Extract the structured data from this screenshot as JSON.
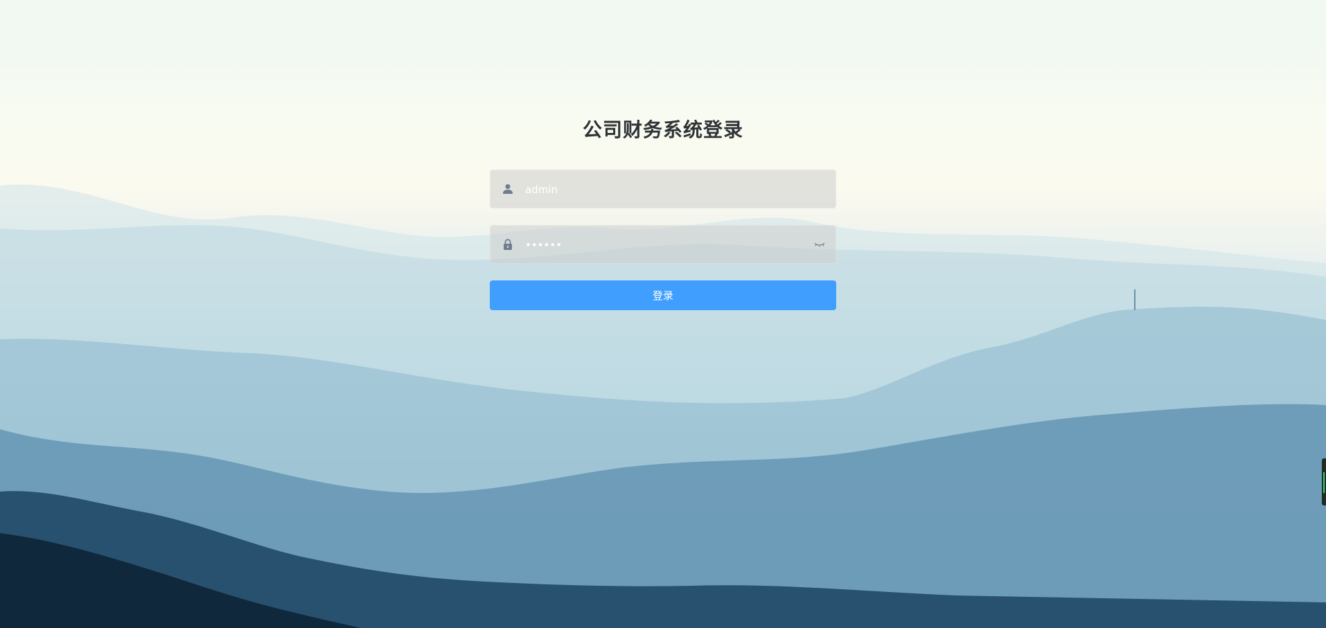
{
  "page": {
    "title": "公司财务系统登录"
  },
  "form": {
    "username_value": "admin",
    "password_value": "••••••",
    "login_button_label": "登录",
    "user_icon": "user-icon",
    "lock_icon": "lock-icon",
    "eye_icon": "eye-off-icon"
  },
  "colors": {
    "accent": "#409eff",
    "title": "#2f3336"
  }
}
